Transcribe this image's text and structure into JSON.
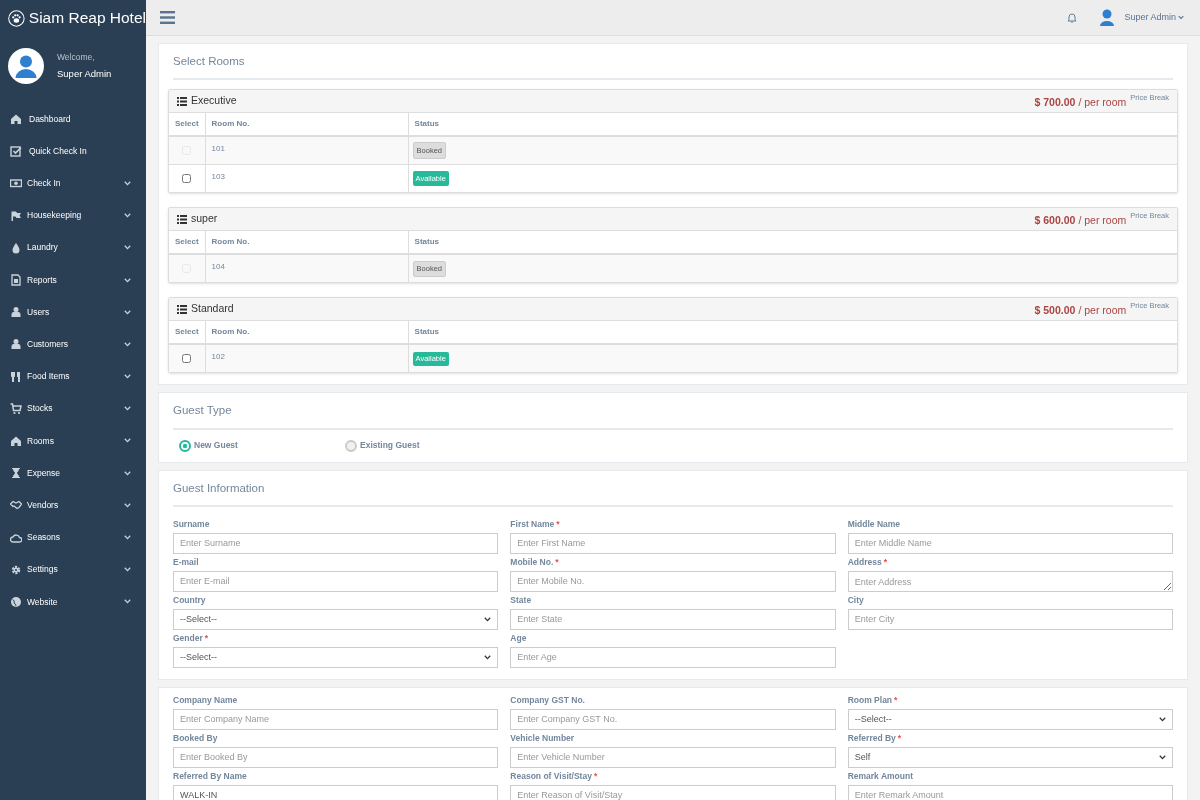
{
  "brand": {
    "title": "Siam Reap Hotel"
  },
  "profile": {
    "welcome": "Welcome,",
    "name": "Super Admin"
  },
  "sidebar": {
    "items": [
      {
        "label": "Dashboard",
        "caret": false
      },
      {
        "label": "Quick Check In",
        "caret": false
      },
      {
        "label": "Check In",
        "caret": true
      },
      {
        "label": "Housekeeping",
        "caret": true
      },
      {
        "label": "Laundry",
        "caret": true
      },
      {
        "label": "Reports",
        "caret": true
      },
      {
        "label": "Users",
        "caret": true
      },
      {
        "label": "Customers",
        "caret": true
      },
      {
        "label": "Food Items",
        "caret": true
      },
      {
        "label": "Stocks",
        "caret": true
      },
      {
        "label": "Rooms",
        "caret": true
      },
      {
        "label": "Expense",
        "caret": true
      },
      {
        "label": "Vendors",
        "caret": true
      },
      {
        "label": "Seasons",
        "caret": true
      },
      {
        "label": "Settings",
        "caret": true
      },
      {
        "label": "Website",
        "caret": true
      }
    ]
  },
  "topbar": {
    "user": "Super Admin"
  },
  "select_rooms": {
    "title": "Select Rooms",
    "groups": [
      {
        "name": "Executive",
        "price": "$ 700.00",
        "unit": "/ per room",
        "link": "Price Break",
        "columns": [
          "Select",
          "Room No.",
          "Status"
        ],
        "rows": [
          {
            "room": "101",
            "status": "Booked",
            "kind": "booked",
            "disabled": true,
            "checked": false
          },
          {
            "room": "103",
            "status": "Available",
            "kind": "available",
            "disabled": false,
            "checked": false
          }
        ]
      },
      {
        "name": "super",
        "price": "$ 600.00",
        "unit": "/ per room",
        "link": "Price Break",
        "columns": [
          "Select",
          "Room No.",
          "Status"
        ],
        "rows": [
          {
            "room": "104",
            "status": "Booked",
            "kind": "booked",
            "disabled": true,
            "checked": false
          }
        ]
      },
      {
        "name": "Standard",
        "price": "$ 500.00",
        "unit": "/ per room",
        "link": "Price Break",
        "columns": [
          "Select",
          "Room No.",
          "Status"
        ],
        "rows": [
          {
            "room": "102",
            "status": "Available",
            "kind": "available",
            "disabled": false,
            "checked": false
          }
        ]
      }
    ]
  },
  "guest_type": {
    "title": "Guest Type",
    "options": [
      {
        "label": "New Guest",
        "selected": true
      },
      {
        "label": "Existing Guest",
        "selected": false
      }
    ]
  },
  "guest_information": {
    "title": "Guest Information",
    "fields": [
      {
        "label": "Surname",
        "kind": "input",
        "placeholder": "Enter Surname"
      },
      {
        "label": "First Name",
        "mark": "*",
        "kind": "input",
        "placeholder": "Enter First Name"
      },
      {
        "label": "Middle Name",
        "kind": "input",
        "placeholder": "Enter Middle Name"
      },
      {
        "label": "E-mail",
        "kind": "input",
        "placeholder": "Enter E-mail"
      },
      {
        "label": "Mobile No.",
        "mark": "*",
        "kind": "input",
        "placeholder": "Enter Mobile No."
      },
      {
        "label": "Address",
        "mark": "*",
        "kind": "textarea",
        "placeholder": "Enter Address"
      },
      {
        "label": "Country",
        "kind": "select",
        "value": "--Select--"
      },
      {
        "label": "State",
        "kind": "input",
        "placeholder": "Enter State"
      },
      {
        "label": "City",
        "kind": "input",
        "placeholder": "Enter City"
      },
      {
        "label": "Gender",
        "mark": "*",
        "kind": "select",
        "value": "--Select--"
      },
      {
        "label": "Age",
        "kind": "input",
        "placeholder": "Enter Age"
      }
    ]
  },
  "booking_details": {
    "fields": [
      {
        "label": "Company Name",
        "kind": "input",
        "placeholder": "Enter Company Name"
      },
      {
        "label": "Company GST No.",
        "kind": "input",
        "placeholder": "Enter Company GST No."
      },
      {
        "label": "Room Plan",
        "mark": "*",
        "kind": "select",
        "value": "--Select--"
      },
      {
        "label": "Booked By",
        "kind": "input",
        "placeholder": "Enter Booked By"
      },
      {
        "label": "Vehicle Number",
        "kind": "input",
        "placeholder": "Enter Vehicle Number"
      },
      {
        "label": "Referred By",
        "mark": "*",
        "kind": "select",
        "value": "Self"
      },
      {
        "label": "Referred By Name",
        "kind": "input",
        "value": "WALK-IN"
      },
      {
        "label": "Reason of Visit/Stay",
        "mark": "*",
        "kind": "input",
        "placeholder": "Enter Reason of Visit/Stay"
      },
      {
        "label": "Remark Amount",
        "kind": "input",
        "placeholder": "Enter Remark Amount"
      }
    ]
  }
}
